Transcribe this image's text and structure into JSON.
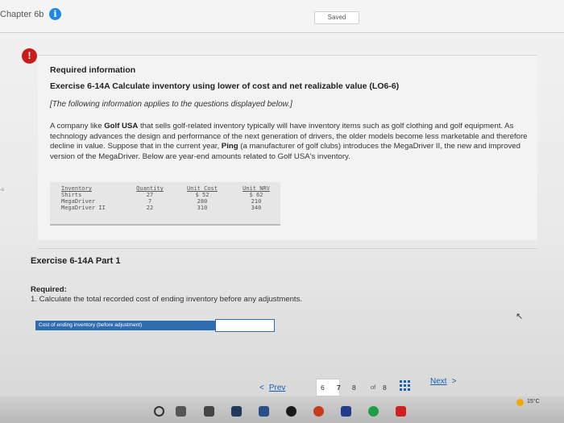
{
  "header": {
    "chapter": "Chapter 6b",
    "saved": "Saved"
  },
  "section": {
    "required_information": "Required information",
    "title": "Exercise 6-14A Calculate inventory using lower of cost and net realizable value (LO6-6)",
    "note": "[The following information applies to the questions displayed below.]",
    "body_intro": "A company like ",
    "company": "Golf USA",
    "body_mid": " that sells golf-related inventory typically will have inventory items such as golf clothing and golf equipment. As technology advances the design and performance of the next generation of drivers, the older models become less marketable and therefore decline in value. Suppose that in the current year, ",
    "manufacturer": "Ping",
    "body_end": " (a manufacturer of golf clubs) introduces the MegaDriver II, the new and improved version of the MegaDriver. Below are year-end amounts related to Golf USA's inventory."
  },
  "inventory_table": {
    "headers": [
      "Inventory",
      "Quantity",
      "Unit Cost",
      "Unit NRV"
    ],
    "rows": [
      {
        "item": "Shirts",
        "quantity": "27",
        "unit_cost": "$ 52",
        "unit_nrv": "$ 62"
      },
      {
        "item": "MegaDriver",
        "quantity": "7",
        "unit_cost": "280",
        "unit_nrv": "210"
      },
      {
        "item": "MegaDriver II",
        "quantity": "22",
        "unit_cost": "310",
        "unit_nrv": "340"
      }
    ]
  },
  "part": {
    "title": "Exercise 6-14A Part 1",
    "required_label": "Required:",
    "question": "1. Calculate the total recorded cost of ending inventory before any adjustments.",
    "answer_label": "Cost of ending inventory (before adjustment)",
    "answer_value": ""
  },
  "navigation": {
    "prev": "Prev",
    "pages": [
      "6",
      "7",
      "8"
    ],
    "current_page": "7",
    "of_label": "of",
    "total": "8",
    "next": "Next"
  },
  "taskbar": {
    "temperature": "15°C"
  },
  "colors": {
    "info_icon": "#1e88e5",
    "alert_icon": "#cc1b1b",
    "link": "#1a5fb4",
    "answer_label_bg": "#2f6db0"
  }
}
